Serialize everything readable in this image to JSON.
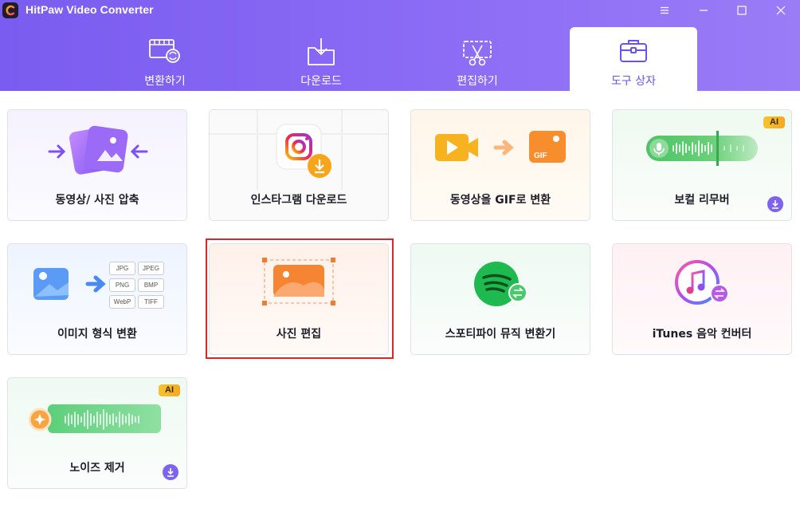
{
  "app": {
    "title": "HitPaw Video Converter"
  },
  "window_controls": [
    "menu-icon",
    "minimize-icon",
    "maximize-icon",
    "close-icon"
  ],
  "tabs": [
    {
      "label": "변환하기",
      "icon": "film-convert-icon",
      "active": false
    },
    {
      "label": "다운로드",
      "icon": "download-folder-icon",
      "active": false
    },
    {
      "label": "편집하기",
      "icon": "scissors-icon",
      "active": false
    },
    {
      "label": "도구 상자",
      "icon": "toolbox-icon",
      "active": true
    }
  ],
  "tools": [
    {
      "label": "동영상/ 사진 압축",
      "icon": "compress-icon",
      "ai": false,
      "download": false
    },
    {
      "label": "인스타그램 다운로드",
      "icon": "instagram-icon",
      "ai": false,
      "download": false
    },
    {
      "label": "동영상을 GIF로 변환",
      "icon": "video-to-gif-icon",
      "ai": false,
      "download": false
    },
    {
      "label": "보컬 리무버",
      "icon": "vocal-remover-icon",
      "ai": true,
      "download": true
    },
    {
      "label": "이미지 형식 변환",
      "icon": "image-convert-icon",
      "ai": false,
      "download": false,
      "formats": [
        "JPG",
        "JPEG",
        "PNG",
        "BMP",
        "WebP",
        "TIFF"
      ]
    },
    {
      "label": "사진 편집",
      "icon": "photo-edit-icon",
      "ai": false,
      "download": false,
      "selected": true
    },
    {
      "label": "스포티파이 뮤직 변환기",
      "icon": "spotify-icon",
      "ai": false,
      "download": false
    },
    {
      "label": "iTunes 음악 컨버터",
      "icon": "itunes-icon",
      "ai": false,
      "download": false
    },
    {
      "label": "노이즈 제거",
      "icon": "noise-remover-icon",
      "ai": true,
      "download": true
    }
  ],
  "badges": {
    "ai": "AI"
  },
  "colors": {
    "accent": "#7a5cf0",
    "selection": "#d42a2a"
  }
}
